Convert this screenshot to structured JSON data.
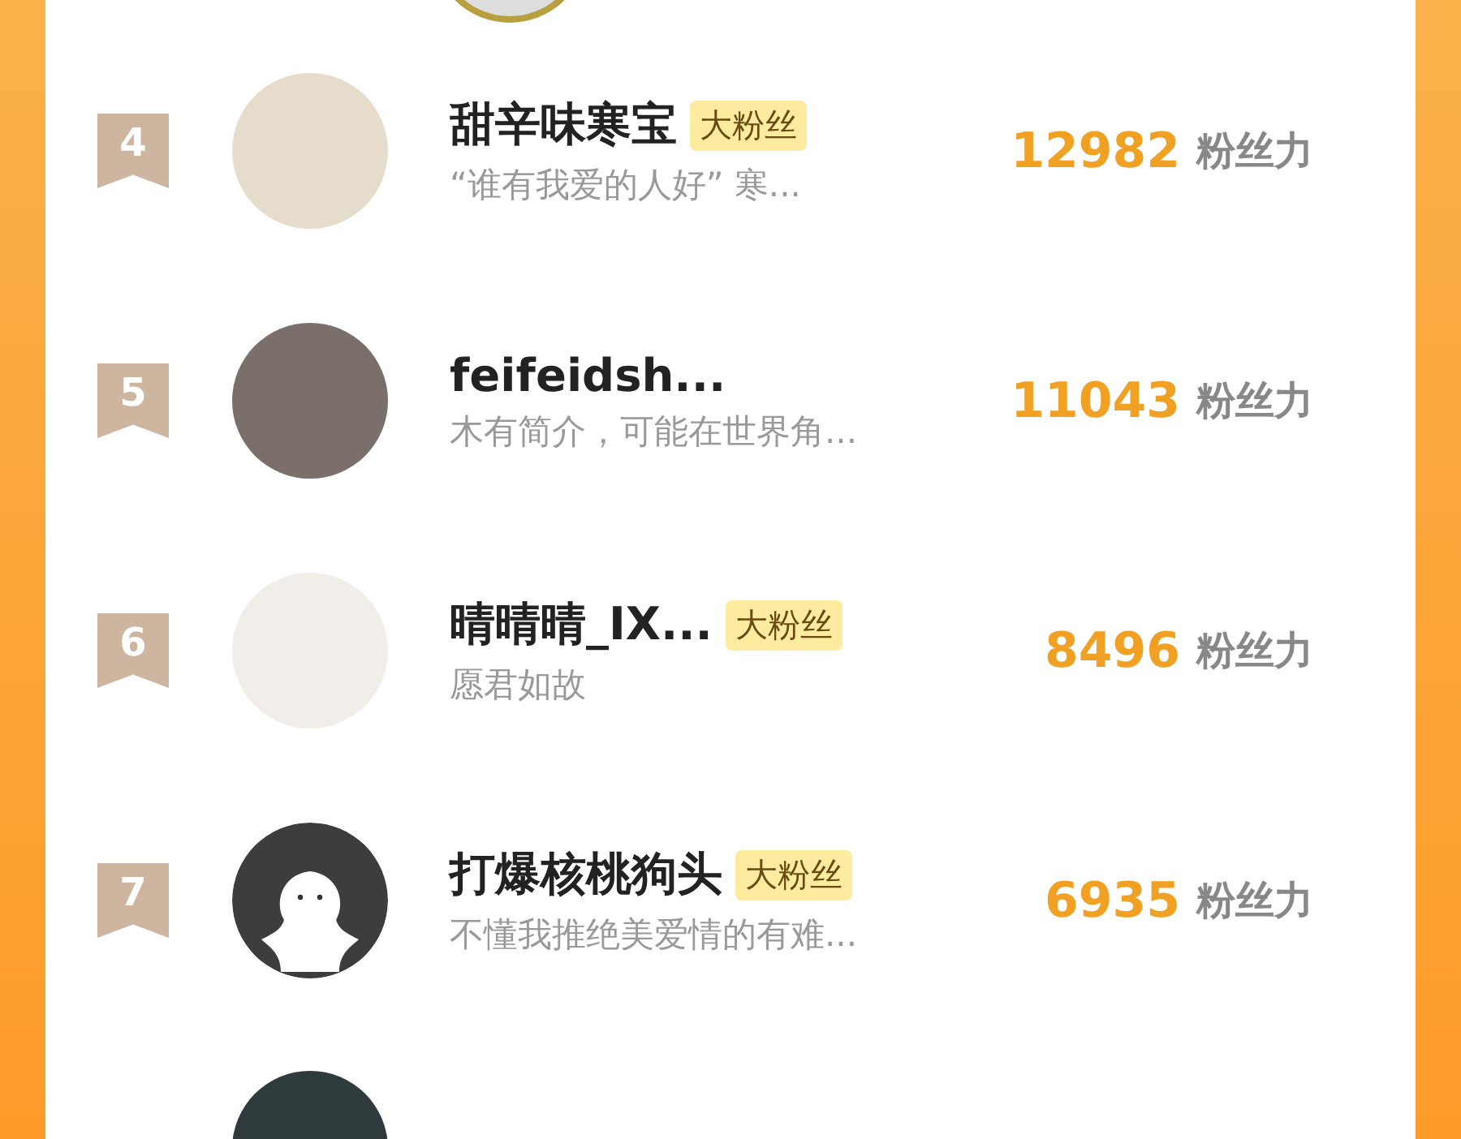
{
  "fans": [
    {
      "rank": "4",
      "kind": "picture",
      "name": "甜辛味寒宝",
      "badge": "大粉丝",
      "bio": "“谁有我爱的人好” 寒...",
      "score": "12982",
      "score_label": "粉丝力"
    },
    {
      "rank": "5",
      "kind": "picture",
      "name": "feifeidsh...",
      "bio": "木有简介，可能在世界角...",
      "score": "11043",
      "score_label": "粉丝力"
    },
    {
      "rank": "6",
      "kind": "picture",
      "name": "晴晴晴_IX...",
      "badge": "大粉丝",
      "bio": "愿君如故",
      "score": "8496",
      "score_label": "粉丝力"
    },
    {
      "rank": "7",
      "kind": "default",
      "name": "打爆核桃狗头",
      "badge": "大粉丝",
      "bio": "不懂我推绝美爱情的有难...",
      "score": "6935",
      "score_label": "粉丝力"
    }
  ]
}
